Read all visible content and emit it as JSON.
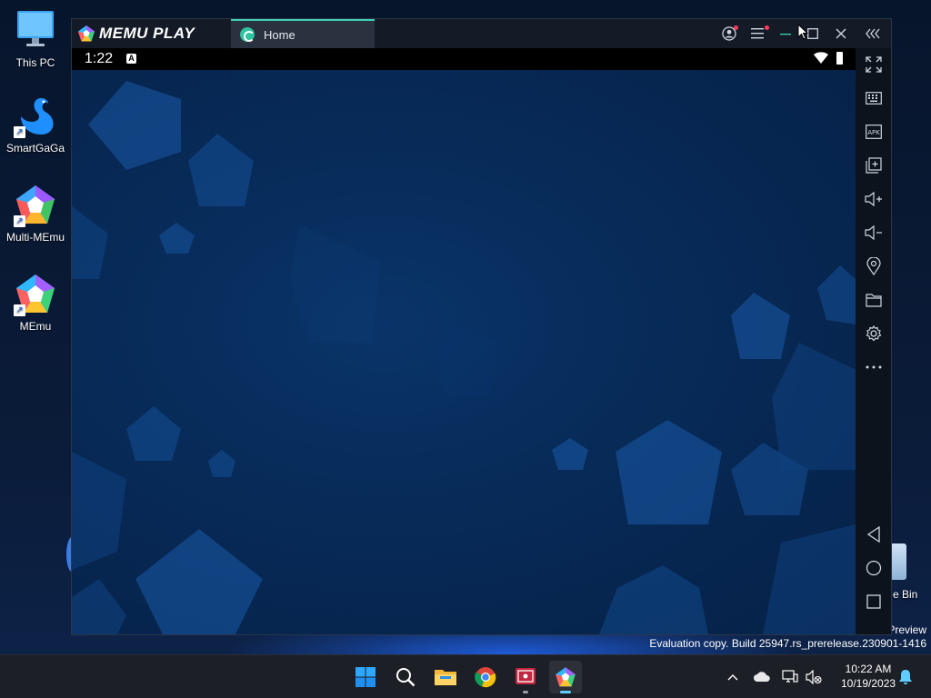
{
  "desktop": {
    "icons": [
      {
        "label": "This PC"
      },
      {
        "label": "SmartGaGa"
      },
      {
        "label": "Multi-MEmu"
      },
      {
        "label": "MEmu"
      }
    ],
    "recycle_bin_partial_label": "e Bin",
    "watermark_line1": "Preview",
    "watermark_line2": "Evaluation copy. Build 25947.rs_prerelease.230901-1416"
  },
  "memu": {
    "logo_text": "MEMU PLAY",
    "tab_label": "Home",
    "android_time": "1:22",
    "sidebar_tools": [
      "fullscreen-icon",
      "keyboard-icon",
      "apk-icon",
      "multi-window-icon",
      "volume-up-icon",
      "volume-down-icon",
      "location-icon",
      "folder-icon",
      "settings-icon",
      "more-icon",
      "back-icon",
      "home-icon",
      "recents-icon"
    ],
    "apk_text": "APK"
  },
  "taskbar": {
    "time": "10:22 AM",
    "date": "10/19/2023"
  },
  "colors": {
    "accent": "#3fd1b5",
    "screen_bg": "#072a57",
    "taskbar_bg": "#1c1f26"
  }
}
